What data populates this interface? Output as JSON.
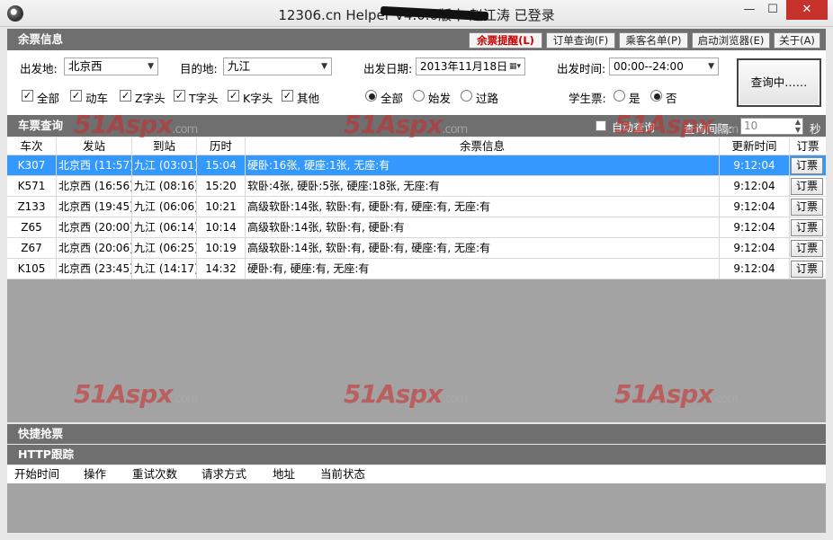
{
  "window": {
    "title": "12306.cn Helper        V4.0.0版本   赵江涛 已登录",
    "min": "—",
    "max": "☐",
    "close": "✕"
  },
  "remaining": {
    "title": "余票信息",
    "buttons": [
      "余票提醒(L)",
      "订单查询(F)",
      "乘客名单(P)",
      "启动浏览器(E)",
      "关于(A)"
    ]
  },
  "query": {
    "from_label": "出发地:",
    "from_value": "北京西",
    "to_label": "目的地:",
    "to_value": "九江",
    "date_label": "出发日期:",
    "date_value": "2013年11月18日",
    "time_label": "出发时间:",
    "time_value": "00:00--24:00",
    "train_types": [
      "全部",
      "动车",
      "Z字头",
      "T字头",
      "K字头",
      "其他"
    ],
    "station_filter": [
      "全部",
      "始发",
      "过路"
    ],
    "student_label": "学生票:",
    "student_options": [
      "是",
      "否"
    ],
    "query_button": "查询中……"
  },
  "tickets": {
    "title": "车票查询",
    "auto_label": "自动查询",
    "interval_label": "查询间隔:",
    "interval_value": "10",
    "interval_unit": "秒",
    "columns": [
      "车次",
      "发站",
      "到站",
      "历时",
      "余票信息",
      "更新时间",
      "订票"
    ],
    "rows": [
      {
        "train": "K307",
        "from": "北京西 (11:57)",
        "to": "九江 (03:01)",
        "duration": "15:04",
        "seats": "硬卧:16张, 硬座:1张, 无座:有",
        "updated": "9:12:04",
        "book": "订票"
      },
      {
        "train": "K571",
        "from": "北京西 (16:56)",
        "to": "九江 (08:16)",
        "duration": "15:20",
        "seats": "软卧:4张, 硬卧:5张, 硬座:18张, 无座:有",
        "updated": "9:12:04",
        "book": "订票"
      },
      {
        "train": "Z133",
        "from": "北京西 (19:45)",
        "to": "九江 (06:06)",
        "duration": "10:21",
        "seats": "高级软卧:14张, 软卧:有, 硬卧:有, 硬座:有, 无座:有",
        "updated": "9:12:04",
        "book": "订票"
      },
      {
        "train": "Z65",
        "from": "北京西 (20:00)",
        "to": "九江 (06:14)",
        "duration": "10:14",
        "seats": "高级软卧:14张, 软卧:有, 硬卧:有",
        "updated": "9:12:04",
        "book": "订票"
      },
      {
        "train": "Z67",
        "from": "北京西 (20:06)",
        "to": "九江 (06:25)",
        "duration": "10:19",
        "seats": "高级软卧:14张, 软卧:有, 硬卧:有, 硬座:有, 无座:有",
        "updated": "9:12:04",
        "book": "订票"
      },
      {
        "train": "K105",
        "from": "北京西 (23:45)",
        "to": "九江 (14:17)",
        "duration": "14:32",
        "seats": "硬卧:有, 硬座:有, 无座:有",
        "updated": "9:12:04",
        "book": "订票"
      }
    ]
  },
  "watermark": {
    "brand": "51Aspx",
    "suffix": ".com"
  },
  "quick": {
    "title": "快捷抢票"
  },
  "http": {
    "title": "HTTP跟踪",
    "columns": [
      "开始时间",
      "操作",
      "重试次数",
      "请求方式",
      "地址",
      "当前状态"
    ]
  }
}
